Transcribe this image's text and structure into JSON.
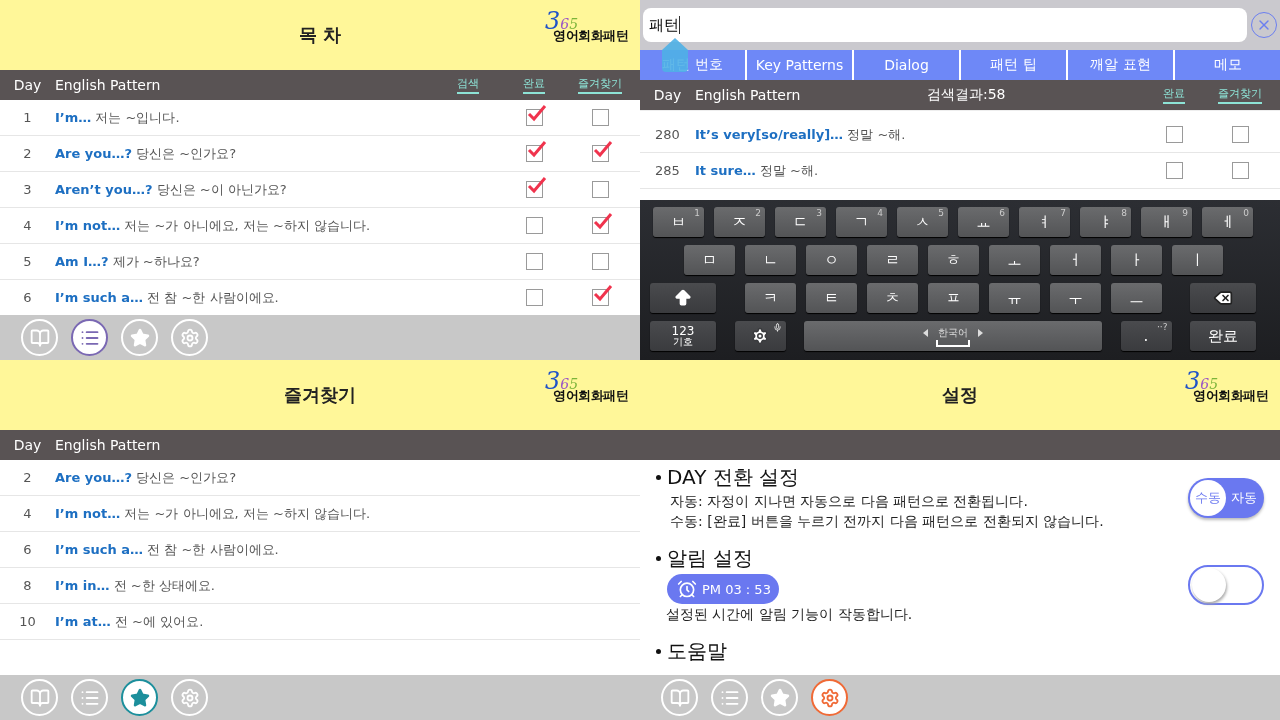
{
  "panels": [
    {
      "kind": "list",
      "title": "목 차",
      "logo": {
        "number": "365",
        "name": "영어회화패턴"
      },
      "header": {
        "day": "Day",
        "pattern": "English Pattern",
        "columns": [
          "검색",
          "완료",
          "즐겨찾기"
        ]
      },
      "rows": [
        {
          "day": "1",
          "en": "I’m…",
          "ko": "저는 ~입니다.",
          "done": true,
          "favorite": false
        },
        {
          "day": "2",
          "en": "Are you…?",
          "ko": "당신은 ~인가요?",
          "done": true,
          "favorite": true
        },
        {
          "day": "3",
          "en": "Aren’t you…?",
          "ko": "당신은 ~이 아닌가요?",
          "done": true,
          "favorite": false
        },
        {
          "day": "4",
          "en": "I’m not…",
          "ko": "저는 ~가 아니에요, 저는 ~하지 않습니다.",
          "done": false,
          "favorite": true
        },
        {
          "day": "5",
          "en": "Am I…?",
          "ko": "제가 ~하나요?",
          "done": false,
          "favorite": false
        },
        {
          "day": "6",
          "en": "I’m such a…",
          "ko": "전 참 ~한 사람이에요.",
          "done": false,
          "favorite": true
        }
      ],
      "nav": [
        {
          "selected": false
        },
        {
          "selected": true
        },
        {
          "selected": false
        },
        {
          "selected": false
        }
      ]
    },
    {
      "kind": "search",
      "search": {
        "value": "패턴"
      },
      "tabs": [
        {
          "label": "패턴 번호",
          "selected": false
        },
        {
          "label": "Key Patterns",
          "selected": false
        },
        {
          "label": "Dialog",
          "selected": false
        },
        {
          "label": "패턴 팁",
          "selected": false
        },
        {
          "label": "깨알 표현",
          "selected": false
        },
        {
          "label": "메모",
          "selected": false
        }
      ],
      "header": {
        "day": "Day",
        "pattern": "English Pattern",
        "result": "검색결과:58",
        "columns": [
          "완료",
          "즐겨찾기"
        ]
      },
      "rows": [
        {
          "day": "280",
          "en": "It’s very[so/really]…",
          "ko": "정말 ~해.",
          "done": false,
          "favorite": false
        },
        {
          "day": "285",
          "en": "It sure…",
          "ko": "정말 ~해.",
          "done": false,
          "favorite": false
        }
      ],
      "keyboard": [
        [
          {
            "kind": "char",
            "label": "ㅂ",
            "hint": "1"
          },
          {
            "kind": "char",
            "label": "ㅈ",
            "hint": "2"
          },
          {
            "kind": "char",
            "label": "ㄷ",
            "hint": "3"
          },
          {
            "kind": "char",
            "label": "ㄱ",
            "hint": "4"
          },
          {
            "kind": "char",
            "label": "ㅅ",
            "hint": "5"
          },
          {
            "kind": "char",
            "label": "ㅛ",
            "hint": "6"
          },
          {
            "kind": "char",
            "label": "ㅕ",
            "hint": "7"
          },
          {
            "kind": "char",
            "label": "ㅑ",
            "hint": "8"
          },
          {
            "kind": "char",
            "label": "ㅐ",
            "hint": "9"
          },
          {
            "kind": "char",
            "label": "ㅔ",
            "hint": "0"
          }
        ],
        [
          {
            "kind": "char",
            "label": "ㅁ"
          },
          {
            "kind": "char",
            "label": "ㄴ"
          },
          {
            "kind": "char",
            "label": "ㅇ"
          },
          {
            "kind": "char",
            "label": "ㄹ"
          },
          {
            "kind": "char",
            "label": "ㅎ"
          },
          {
            "kind": "char",
            "label": "ㅗ"
          },
          {
            "kind": "char",
            "label": "ㅓ"
          },
          {
            "kind": "char",
            "label": "ㅏ"
          },
          {
            "kind": "char",
            "label": "ㅣ"
          }
        ],
        [
          {
            "kind": "shift"
          },
          {
            "kind": "char",
            "label": "ㅋ"
          },
          {
            "kind": "char",
            "label": "ㅌ"
          },
          {
            "kind": "char",
            "label": "ㅊ"
          },
          {
            "kind": "char",
            "label": "ㅍ"
          },
          {
            "kind": "char",
            "label": "ㅠ"
          },
          {
            "kind": "char",
            "label": "ㅜ"
          },
          {
            "kind": "char",
            "label": "ㅡ"
          },
          {
            "kind": "backspace"
          }
        ],
        [
          {
            "kind": "symbols",
            "label": "123",
            "hint": "기호"
          },
          {
            "kind": "settings"
          },
          {
            "kind": "space",
            "label": "한국어"
          },
          {
            "kind": "period",
            "label": ".",
            "hint": "··?"
          },
          {
            "kind": "done",
            "label": "완료"
          }
        ]
      ]
    },
    {
      "kind": "list",
      "title": "즐겨찾기",
      "logo": {
        "number": "365",
        "name": "영어회화패턴"
      },
      "header": {
        "day": "Day",
        "pattern": "English Pattern"
      },
      "rows": [
        {
          "day": "2",
          "en": "Are you…?",
          "ko": "당신은 ~인가요?"
        },
        {
          "day": "4",
          "en": "I’m not…",
          "ko": "저는 ~가 아니에요, 저는 ~하지 않습니다."
        },
        {
          "day": "6",
          "en": "I’m such a…",
          "ko": "전 참 ~한 사람이에요."
        },
        {
          "day": "8",
          "en": "I’m in…",
          "ko": "전 ~한 상태에요."
        },
        {
          "day": "10",
          "en": "I’m at…",
          "ko": "전 ~에 있어요."
        }
      ],
      "nav": [
        {
          "selected": false
        },
        {
          "selected": false
        },
        {
          "selected": true
        },
        {
          "selected": false
        }
      ]
    },
    {
      "kind": "settings",
      "title": "설정",
      "logo": {
        "number": "365",
        "name": "영어회화패턴"
      },
      "sections": [
        {
          "heading": "DAY 전환 설정",
          "lines": [
            "자동: 자정이 지나면 자동으로 다음 패턴으로 전환됩니다.",
            "수동: [완료] 버튼을 누르기 전까지 다음 패턴으로 전환되지 않습니다."
          ],
          "toggle": {
            "kind": "segmented",
            "options": [
              {
                "label": "수동",
                "selected": true
              },
              {
                "label": "자동",
                "selected": false
              }
            ]
          }
        },
        {
          "heading": "알림 설정",
          "time": "PM 03 : 53",
          "lines": [
            "설정된 시간에 알림 기능이 작동합니다."
          ],
          "toggle": {
            "kind": "switch",
            "on": false
          }
        },
        {
          "heading": "도움말"
        }
      ],
      "nav": [
        {
          "selected": false
        },
        {
          "selected": false
        },
        {
          "selected": false
        },
        {
          "selected": true
        }
      ]
    }
  ]
}
